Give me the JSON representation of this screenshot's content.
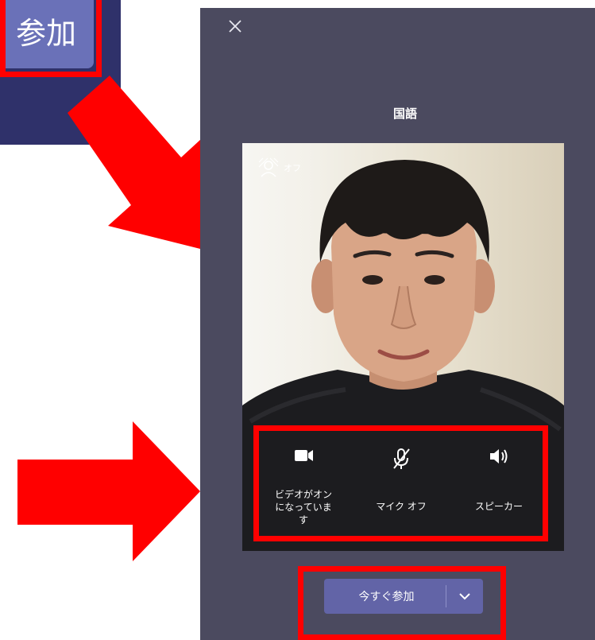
{
  "inset": {
    "join_label": "参加"
  },
  "meeting": {
    "title": "国語"
  },
  "background": {
    "icon": "background-effects-icon",
    "label": "オフ"
  },
  "controls": [
    {
      "icon": "video-camera-icon",
      "label": "ビデオがオン\nになっていま\nす"
    },
    {
      "icon": "microphone-off-icon",
      "label": "マイク オフ"
    },
    {
      "icon": "speaker-icon",
      "label": "スピーカー"
    }
  ],
  "join": {
    "label": "今すぐ参加",
    "dropdown_icon": "chevron-down-icon"
  },
  "colors": {
    "accent": "#6264a7",
    "highlight": "#ff0000",
    "panel": "#4b4a5f",
    "inset_bg": "#2f316a"
  }
}
